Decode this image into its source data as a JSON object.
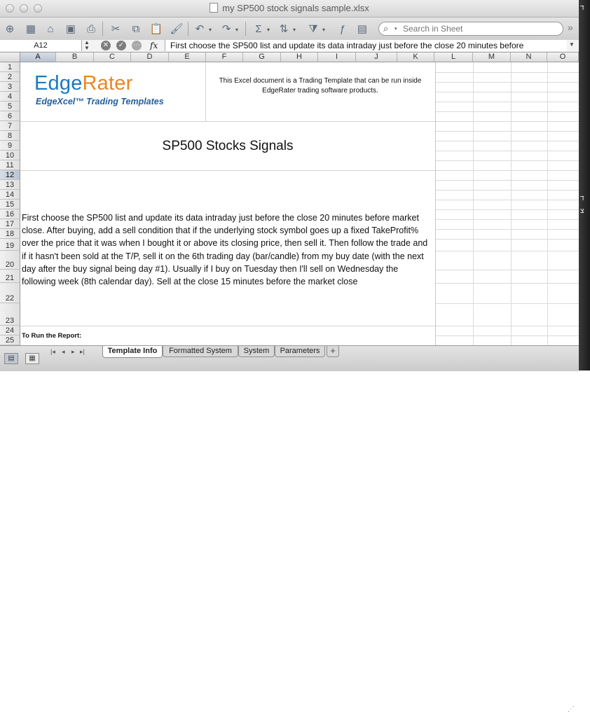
{
  "window": {
    "title": "my SP500 stock signals sample.xlsx"
  },
  "toolbar": {
    "buttons": [
      {
        "name": "new-icon",
        "glyph": "⊕"
      },
      {
        "name": "templates-icon",
        "glyph": "▦"
      },
      {
        "name": "open-icon",
        "glyph": "⌂"
      },
      {
        "name": "save-icon",
        "glyph": "▣"
      },
      {
        "name": "print-icon",
        "glyph": "⎙"
      },
      {
        "name": "cut-icon",
        "glyph": "✂"
      },
      {
        "name": "copy-icon",
        "glyph": "⧉"
      },
      {
        "name": "paste-icon",
        "glyph": "📋"
      },
      {
        "name": "format-brush-icon",
        "glyph": "🖌"
      },
      {
        "name": "undo-icon",
        "glyph": "↶"
      },
      {
        "name": "redo-icon",
        "glyph": "↷"
      },
      {
        "name": "autosum-icon",
        "glyph": "Σ"
      },
      {
        "name": "sort-icon",
        "glyph": "⇅"
      },
      {
        "name": "filter-icon",
        "glyph": "⧩"
      },
      {
        "name": "function-icon",
        "glyph": "ƒ"
      },
      {
        "name": "gallery-icon",
        "glyph": "▤"
      }
    ],
    "search_placeholder": "Search in Sheet"
  },
  "formula_bar": {
    "cell_ref": "A12",
    "fx_label": "fx",
    "content": "First choose the SP500 list and update its data intraday just before the close 20 minutes before"
  },
  "grid": {
    "active_column": "A",
    "active_row": "12",
    "columns": [
      "A",
      "B",
      "C",
      "D",
      "E",
      "F",
      "G",
      "H",
      "I",
      "J",
      "K",
      "L",
      "M",
      "N",
      "O"
    ],
    "rows": [
      "1",
      "2",
      "3",
      "4",
      "5",
      "6",
      "7",
      "8",
      "9",
      "10",
      "11",
      "12",
      "13",
      "14",
      "15",
      "16",
      "17",
      "18",
      "19",
      "20",
      "21",
      "22",
      "23",
      "24",
      "25"
    ]
  },
  "content": {
    "logo_main": "EdgeRater",
    "logo_sub": "EdgeXcel™ Trading Templates",
    "intro": "This Excel document is a Trading Template that can be run inside EdgeRater trading software products.",
    "heading": "SP500 Stocks Signals",
    "description": "First choose the SP500 list and update its data intraday just before the close 20 minutes before market close. After buying, add a sell condition that if the underlying stock symbol goes up a fixed TakeProfit% over the price that it was when I bought it or above its closing price, then sell it. Then follow the trade and if it hasn't been sold at the T/P, sell it on the 6th trading day (bar/candle) from my buy date (with the next day after the buy signal being day #1). Usually if I buy on Tuesday then I'll sell on Wednesday the following week (8th calendar day). Sell at the close 15 minutes before the market close",
    "run_label": "To Run the Report:"
  },
  "sheet_tabs": {
    "tabs": [
      "Template Info",
      "Formatted System",
      "System",
      "Parameters"
    ],
    "active": "Template Info",
    "add_label": "+"
  },
  "colors": {
    "logo_blue": "#1c79c0",
    "logo_orange": "#e88624",
    "logo_sub_blue": "#1f5e9c",
    "header_active": "#b9c4d2"
  }
}
